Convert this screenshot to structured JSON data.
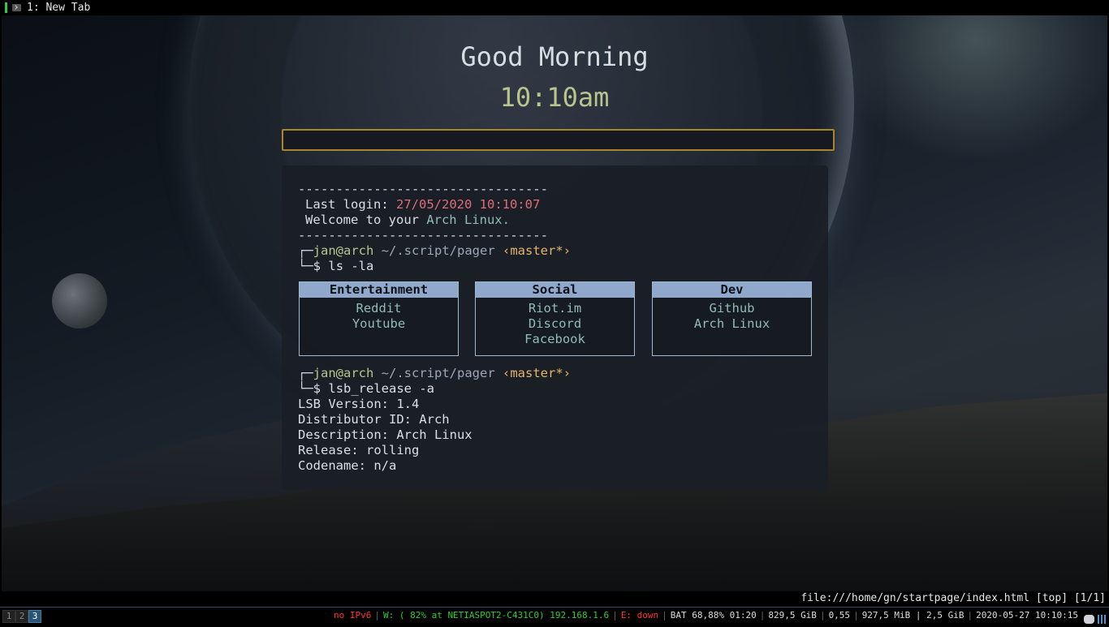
{
  "tab": {
    "title": "1: New Tab"
  },
  "greeting": "Good Morning",
  "clock": "10:10am",
  "search": {
    "value": ""
  },
  "terminal": {
    "divider": "---------------------------------",
    "last_login_label": "Last login:",
    "last_login_value": "27/05/2020 10:10:07",
    "welcome_prefix": "Welcome to your ",
    "welcome_os": "Arch Linux.",
    "prompt": {
      "corner_top": "┌─",
      "user_host": "jan@arch",
      "path": "~/.script/pager",
      "branch": "‹master*›",
      "corner_bottom": "└─",
      "dollar": "$"
    },
    "cmd1": "ls -la",
    "cmd2": "lsb_release -a",
    "lsb": {
      "version": "LSB Version: 1.4",
      "distributor": "Distributor ID: Arch",
      "description": "Description: Arch Linux",
      "release": "Release: rolling",
      "codename": "Codename: n/a"
    }
  },
  "boxes": [
    {
      "title": "Entertainment",
      "links": [
        "Reddit",
        "Youtube"
      ]
    },
    {
      "title": "Social",
      "links": [
        "Riot.im",
        "Discord",
        "Facebook"
      ]
    },
    {
      "title": "Dev",
      "links": [
        "Github",
        "Arch Linux"
      ]
    }
  ],
  "url_status": "file:///home/gn/startpage/index.html [top] [1/1]",
  "workspaces": [
    "1",
    "2",
    "3"
  ],
  "status": {
    "ipv6": "no IPv6",
    "wifi": "W: ( 82% at NETIASPOT2-C431C0) 192.168.1.6",
    "eth": "E: down",
    "battery": "BAT 68,88% 01:20",
    "disk": "829,5 GiB",
    "load": "0,55",
    "mem": "927,5 MiB | 2,5 GiB",
    "datetime": "2020-05-27 10:10:15"
  },
  "tray_icons": [
    "discord-icon",
    "signal-icon"
  ]
}
